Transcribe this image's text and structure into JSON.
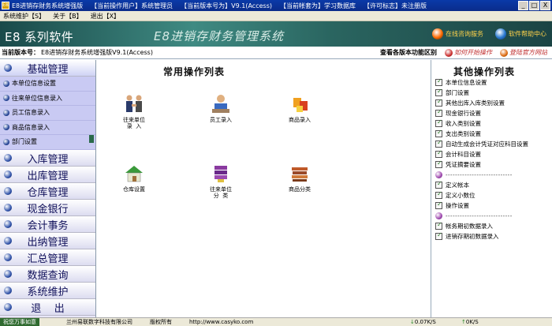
{
  "titlebar": {
    "app": "E8进销存财务系统增强版",
    "current_user": "【当前操作用户】",
    "user_name": "系统管理员",
    "version_label": "【当前版本号为】",
    "version_value": "V9.1(Access)",
    "account_label": "【当前帐套为】",
    "account_value": "学习数据库",
    "license_label": "【许可标志】",
    "license_value": "未注册版",
    "min": "_",
    "max": "□",
    "close": "X"
  },
  "menu": [
    "系统维护【S】",
    "关于【B】",
    "退出【X】"
  ],
  "banner": {
    "brand": "E8 系列软件",
    "title": "E8进销存财务管理系统",
    "link1": "在线咨询服务",
    "link2": "软件帮助中心"
  },
  "info": {
    "label": "当前版本号：",
    "value": "E8进销存财务系统增强版V9.1(Access)",
    "compare": "查看各版本功能区别",
    "howto": "如何开始操作",
    "site": "登陆官方网站"
  },
  "leftnav": {
    "top": "基础管理",
    "sub": [
      "本单位信息设置",
      "往来单位信息录入",
      "员工信息录入",
      "商品信息录入",
      "部门设置"
    ],
    "cats": [
      "入库管理",
      "出库管理",
      "仓库管理",
      "现金银行",
      "会计事务",
      "出纳管理",
      "汇总管理",
      "数据查询",
      "系统维护",
      "退    出"
    ]
  },
  "center": {
    "heading": "常用操作列表",
    "tiles": [
      {
        "label": "往来单位\n录  入",
        "icon": "handshake-icon"
      },
      {
        "label": "员工录入",
        "icon": "employee-icon"
      },
      {
        "label": "商品录入",
        "icon": "goods-icon"
      },
      {
        "label": "仓库设置",
        "icon": "warehouse-icon"
      },
      {
        "label": "往来单位\n分  类",
        "icon": "books-icon"
      },
      {
        "label": "商品分类",
        "icon": "stack-icon"
      }
    ]
  },
  "right": {
    "heading": "其他操作列表",
    "group1": [
      "本单位信息设置",
      "部门设置",
      "其他出库入库类别设置",
      "现金银行设置",
      "收入类别设置",
      "支出类别设置",
      "自动生成会计凭证对应科目设置",
      "会计科目设置",
      "凭证摘要设置"
    ],
    "group2": [
      "定义帐本",
      "定义小数位",
      "操作设置"
    ],
    "group3": [
      "帐务期初数据录入",
      "进销存期初数据录入"
    ],
    "separator": "----------------------------"
  },
  "status": {
    "start": "祝您万事如意",
    "company": "兰州易联数字科技有限公司",
    "rights": "版权所有",
    "url": "http://www.casyko.com",
    "down": "0.07K/S",
    "up": "0K/S"
  }
}
